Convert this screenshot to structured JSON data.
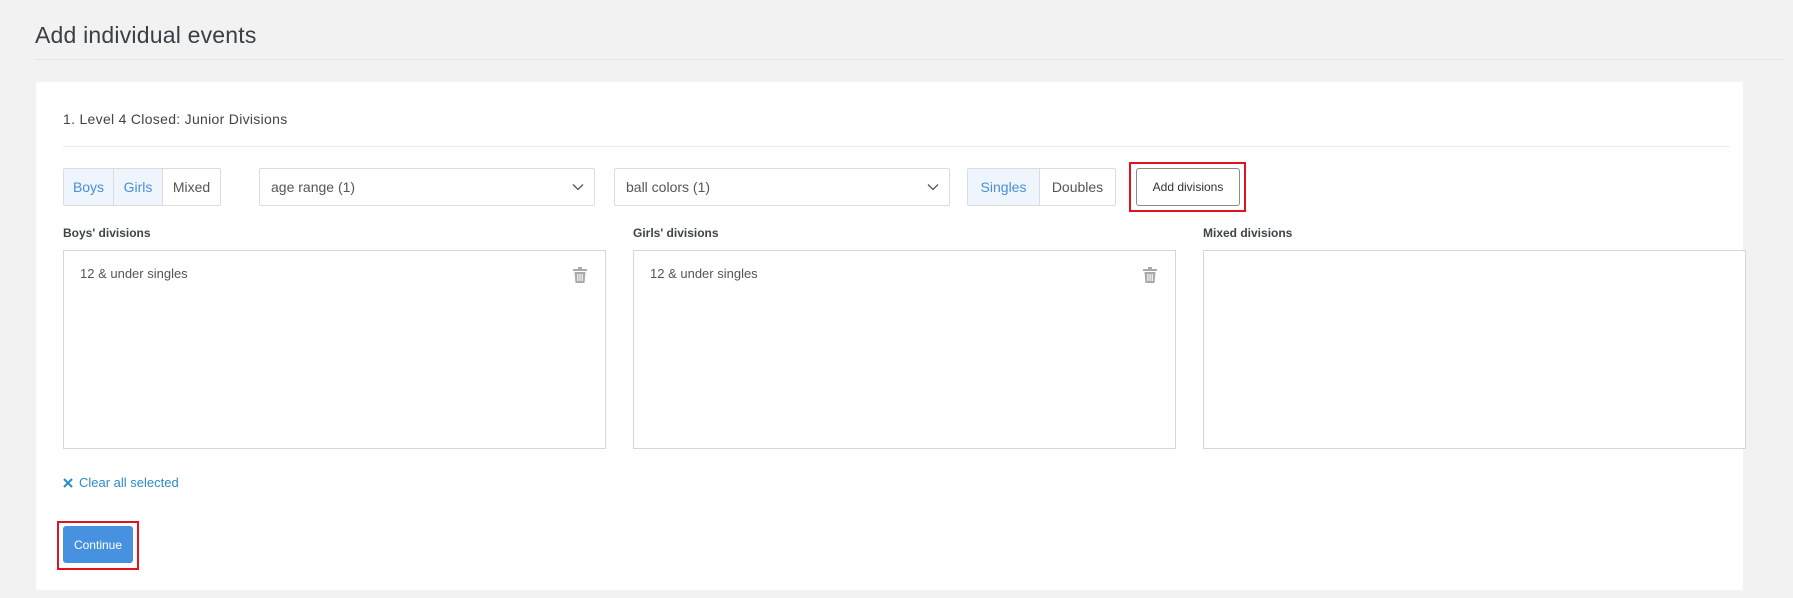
{
  "page": {
    "title": "Add individual events"
  },
  "event": {
    "title": "1.  Level 4 Closed: Junior Divisions",
    "gender_options": [
      {
        "label": "Boys",
        "active": true
      },
      {
        "label": "Girls",
        "active": true
      },
      {
        "label": "Mixed",
        "active": false
      }
    ],
    "age_range": {
      "value": "age range (1)",
      "icon": "chevron-down-icon"
    },
    "ball_colors": {
      "value": "ball colors (1)",
      "icon": "chevron-down-icon"
    },
    "type_options": [
      {
        "label": "Singles",
        "active": true
      },
      {
        "label": "Doubles",
        "active": false
      }
    ],
    "add_divisions_label": "Add divisions",
    "columns": {
      "boys": {
        "label": "Boys' divisions",
        "items": [
          "12 & under singles"
        ]
      },
      "girls": {
        "label": "Girls' divisions",
        "items": [
          "12 & under singles"
        ]
      },
      "mixed": {
        "label": "Mixed divisions",
        "items": []
      }
    },
    "clear_label": "Clear all selected",
    "continue_label": "Continue"
  },
  "colors": {
    "accent": "#4792e0",
    "active_segment_bg": "#eef5fc",
    "active_segment_text": "#4a8fd9",
    "link": "#2b8ccc",
    "highlight": "#e0141e"
  }
}
